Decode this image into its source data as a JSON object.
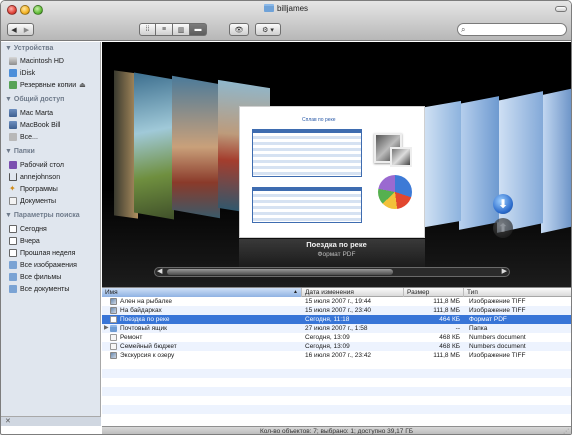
{
  "window": {
    "title": "billjames"
  },
  "toolbar": {
    "back_label": "◀",
    "forward_label": "▶",
    "view_icons": [
      "⁞⁞",
      "≡",
      "▥",
      "▬"
    ],
    "quick_look_label": "👁",
    "action_label": "⚙ ▾",
    "search_placeholder": "",
    "search_icon": "magnifier-icon"
  },
  "sidebar": {
    "sections": [
      {
        "title": "Устройства",
        "items": [
          {
            "label": "Macintosh HD",
            "icon": "harddisk-icon"
          },
          {
            "label": "iDisk",
            "icon": "idisk-icon"
          },
          {
            "label": "Резервные копии",
            "icon": "backup-icon",
            "eject": "⏏"
          }
        ]
      },
      {
        "title": "Общий доступ",
        "items": [
          {
            "label": "Mac Marta",
            "icon": "computer-icon"
          },
          {
            "label": "MacBook Bill",
            "icon": "computer-icon"
          },
          {
            "label": "Все...",
            "icon": "network-icon"
          }
        ]
      },
      {
        "title": "Папки",
        "items": [
          {
            "label": "Рабочий стол",
            "icon": "desktop-icon"
          },
          {
            "label": "annejohnson",
            "icon": "home-icon"
          },
          {
            "label": "Программы",
            "icon": "apps-icon"
          },
          {
            "label": "Документы",
            "icon": "documents-icon"
          }
        ]
      },
      {
        "title": "Параметры поиска",
        "items": [
          {
            "label": "Сегодня",
            "icon": "clock-icon"
          },
          {
            "label": "Вчера",
            "icon": "clock-icon"
          },
          {
            "label": "Прошлая неделя",
            "icon": "clock-icon"
          },
          {
            "label": "Все изображения",
            "icon": "smart-folder-icon"
          },
          {
            "label": "Все фильмы",
            "icon": "smart-folder-icon"
          },
          {
            "label": "Все документы",
            "icon": "smart-folder-icon"
          }
        ]
      }
    ],
    "bottom_icon": "✕"
  },
  "coverflow": {
    "selected_name": "Поездка по реке",
    "selected_kind": "Формат PDF",
    "doc_title": "Сплав по реке",
    "scroll_left": "◀",
    "scroll_right": "▶",
    "download_arrow": "⬇",
    "up_arrow": "⬆"
  },
  "list": {
    "columns": [
      "Имя",
      "Дата изменения",
      "Размер",
      "Тип"
    ],
    "sort_indicator": "▲",
    "rows": [
      {
        "name": "Ален на рыбалке",
        "date": "15 июля 2007 г., 19:44",
        "size": "111,8 МБ",
        "type": "Изображение TIFF",
        "icon": "tiff"
      },
      {
        "name": "На байдарках",
        "date": "15 июля 2007 г., 23:40",
        "size": "111,8 МБ",
        "type": "Изображение TIFF",
        "icon": "tiff"
      },
      {
        "name": "Поездка по реке",
        "date": "Сегодня, 11:18",
        "size": "464 КБ",
        "type": "Формат PDF",
        "icon": "pdf",
        "selected": true
      },
      {
        "name": "Почтовый ящик",
        "date": "27 июля 2007 г., 1:58",
        "size": "--",
        "type": "Папка",
        "icon": "mail",
        "disclosure": "▶"
      },
      {
        "name": "Ремонт",
        "date": "Сегодня, 13:09",
        "size": "468 КБ",
        "type": "Numbers document",
        "icon": "numbers"
      },
      {
        "name": "Семейный бюджет",
        "date": "Сегодня, 13:09",
        "size": "468 КБ",
        "type": "Numbers document",
        "icon": "numbers"
      },
      {
        "name": "Экскурсия к озеру",
        "date": "16 июля 2007 г., 23:42",
        "size": "111,8 МБ",
        "type": "Изображение TIFF",
        "icon": "tiff"
      }
    ]
  },
  "status": {
    "text": "Кол-во объектов: 7; выбрано: 1; доступно 39,17 ГБ",
    "resize_glyph": "⋰"
  },
  "colors": {
    "selection": "#3875d7",
    "sidebar_bg": "#e0e6ee",
    "stripe": "#edf3fe"
  }
}
